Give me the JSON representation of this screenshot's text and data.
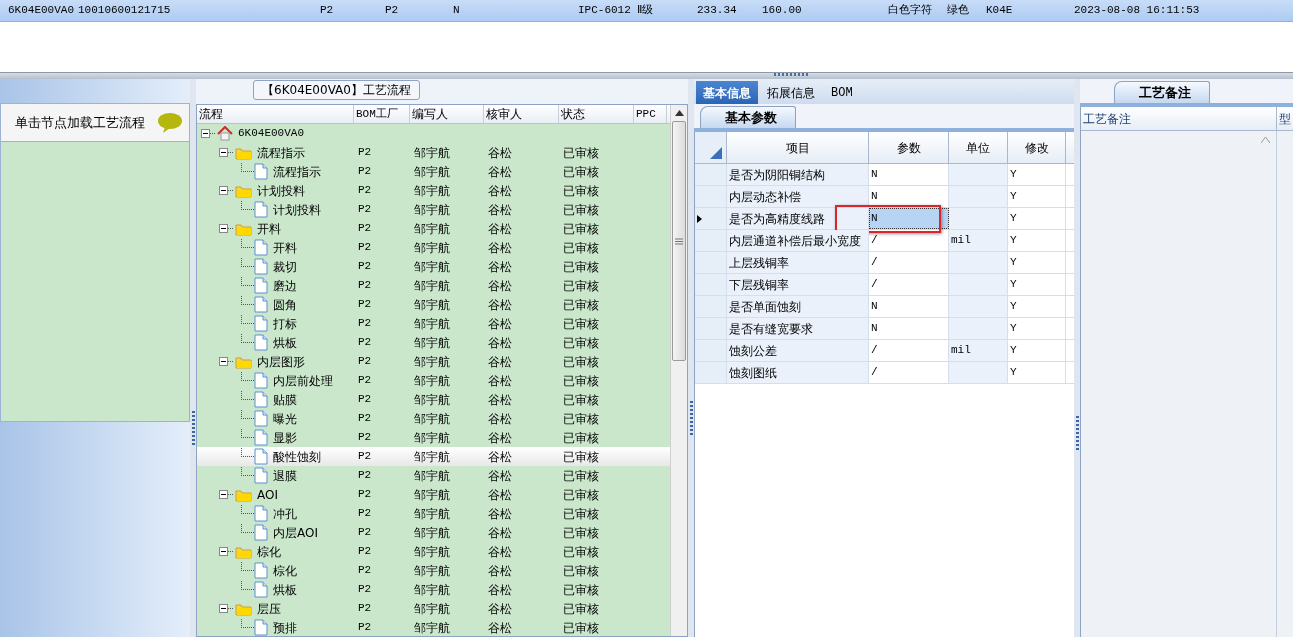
{
  "record_bar": {
    "cells": [
      "6K04E00VA0",
      "10010600121715",
      "P2",
      "P2",
      "N",
      "IPC-6012 Ⅱ级",
      "233.34",
      "160.00",
      "白色字符",
      "绿色",
      "K04E",
      "2023-08-08 16:11:53"
    ]
  },
  "left_panel": {
    "hint": "单击节点加载工艺流程"
  },
  "process_panel": {
    "title": "【6K04E00VA0】工艺流程",
    "columns": [
      "流程",
      "BOM工厂",
      "编写人",
      "核审人",
      "状态",
      "PPC"
    ],
    "tree": [
      {
        "label": "6K04E00VA0",
        "kind": "root",
        "expanded": true,
        "selected": false,
        "children": [
          {
            "label": "流程指示",
            "kind": "folder",
            "expanded": true,
            "selected": false,
            "bom_plant": "P2",
            "writer": "邹宇航",
            "reviewer": "谷松",
            "status": "已审核",
            "children": [
              {
                "label": "流程指示",
                "kind": "step",
                "selected": false,
                "bom_plant": "P2",
                "writer": "邹宇航",
                "reviewer": "谷松",
                "status": "已审核"
              }
            ]
          },
          {
            "label": "计划投料",
            "kind": "folder",
            "expanded": true,
            "selected": false,
            "bom_plant": "P2",
            "writer": "邹宇航",
            "reviewer": "谷松",
            "status": "已审核",
            "children": [
              {
                "label": "计划投料",
                "kind": "step",
                "selected": false,
                "bom_plant": "P2",
                "writer": "邹宇航",
                "reviewer": "谷松",
                "status": "已审核"
              }
            ]
          },
          {
            "label": "开料",
            "kind": "folder",
            "expanded": true,
            "selected": false,
            "bom_plant": "P2",
            "writer": "邹宇航",
            "reviewer": "谷松",
            "status": "已审核",
            "children": [
              {
                "label": "开料",
                "kind": "step",
                "selected": false,
                "bom_plant": "P2",
                "writer": "邹宇航",
                "reviewer": "谷松",
                "status": "已审核"
              },
              {
                "label": "裁切",
                "kind": "step",
                "selected": false,
                "bom_plant": "P2",
                "writer": "邹宇航",
                "reviewer": "谷松",
                "status": "已审核"
              },
              {
                "label": "磨边",
                "kind": "step",
                "selected": false,
                "bom_plant": "P2",
                "writer": "邹宇航",
                "reviewer": "谷松",
                "status": "已审核"
              },
              {
                "label": "圆角",
                "kind": "step",
                "selected": false,
                "bom_plant": "P2",
                "writer": "邹宇航",
                "reviewer": "谷松",
                "status": "已审核"
              },
              {
                "label": "打标",
                "kind": "step",
                "selected": false,
                "bom_plant": "P2",
                "writer": "邹宇航",
                "reviewer": "谷松",
                "status": "已审核"
              },
              {
                "label": "烘板",
                "kind": "step",
                "selected": false,
                "bom_plant": "P2",
                "writer": "邹宇航",
                "reviewer": "谷松",
                "status": "已审核"
              }
            ]
          },
          {
            "label": "内层图形",
            "kind": "folder",
            "expanded": true,
            "selected": false,
            "bom_plant": "P2",
            "writer": "邹宇航",
            "reviewer": "谷松",
            "status": "已审核",
            "children": [
              {
                "label": "内层前处理",
                "kind": "step",
                "selected": false,
                "bom_plant": "P2",
                "writer": "邹宇航",
                "reviewer": "谷松",
                "status": "已审核"
              },
              {
                "label": "贴膜",
                "kind": "step",
                "selected": false,
                "bom_plant": "P2",
                "writer": "邹宇航",
                "reviewer": "谷松",
                "status": "已审核"
              },
              {
                "label": "曝光",
                "kind": "step",
                "selected": false,
                "bom_plant": "P2",
                "writer": "邹宇航",
                "reviewer": "谷松",
                "status": "已审核"
              },
              {
                "label": "显影",
                "kind": "step",
                "selected": false,
                "bom_plant": "P2",
                "writer": "邹宇航",
                "reviewer": "谷松",
                "status": "已审核"
              },
              {
                "label": "酸性蚀刻",
                "kind": "step",
                "selected": true,
                "bom_plant": "P2",
                "writer": "邹宇航",
                "reviewer": "谷松",
                "status": "已审核"
              },
              {
                "label": "退膜",
                "kind": "step",
                "selected": false,
                "bom_plant": "P2",
                "writer": "邹宇航",
                "reviewer": "谷松",
                "status": "已审核"
              }
            ]
          },
          {
            "label": "AOI",
            "kind": "folder",
            "expanded": true,
            "selected": false,
            "bom_plant": "P2",
            "writer": "邹宇航",
            "reviewer": "谷松",
            "status": "已审核",
            "children": [
              {
                "label": "冲孔",
                "kind": "step",
                "selected": false,
                "bom_plant": "P2",
                "writer": "邹宇航",
                "reviewer": "谷松",
                "status": "已审核"
              },
              {
                "label": "内层AOI",
                "kind": "step",
                "selected": false,
                "bom_plant": "P2",
                "writer": "邹宇航",
                "reviewer": "谷松",
                "status": "已审核"
              }
            ]
          },
          {
            "label": "棕化",
            "kind": "folder",
            "expanded": true,
            "selected": false,
            "bom_plant": "P2",
            "writer": "邹宇航",
            "reviewer": "谷松",
            "status": "已审核",
            "children": [
              {
                "label": "棕化",
                "kind": "step",
                "selected": false,
                "bom_plant": "P2",
                "writer": "邹宇航",
                "reviewer": "谷松",
                "status": "已审核"
              },
              {
                "label": "烘板",
                "kind": "step",
                "selected": false,
                "bom_plant": "P2",
                "writer": "邹宇航",
                "reviewer": "谷松",
                "status": "已审核"
              }
            ]
          },
          {
            "label": "层压",
            "kind": "folder",
            "expanded": true,
            "selected": false,
            "bom_plant": "P2",
            "writer": "邹宇航",
            "reviewer": "谷松",
            "status": "已审核",
            "children": [
              {
                "label": "预排",
                "kind": "step",
                "selected": false,
                "bom_plant": "P2",
                "writer": "邹宇航",
                "reviewer": "谷松",
                "status": "已审核"
              }
            ]
          }
        ]
      }
    ]
  },
  "detail_panel": {
    "tabs": [
      {
        "label": "基本信息",
        "selected": true
      },
      {
        "label": "拓展信息",
        "selected": false
      },
      {
        "label": "BOM",
        "selected": false
      }
    ],
    "subtab": {
      "label": "基本参数",
      "selected": true
    },
    "columns": [
      "项目",
      "参数",
      "单位",
      "修改"
    ],
    "rows": [
      {
        "item": "是否为阴阳铜结构",
        "param": "N",
        "modified": "Y",
        "current": false,
        "marked": false
      },
      {
        "item": "内层动态补偿",
        "param": "N",
        "modified": "Y",
        "current": false,
        "marked": false
      },
      {
        "item": "是否为高精度线路",
        "param": "N",
        "modified": "Y",
        "current": true,
        "marked": true
      },
      {
        "item": "内层通道补偿后最小宽度",
        "param": "/",
        "unit": "mil",
        "modified": "Y",
        "current": false,
        "marked": false
      },
      {
        "item": "上层残铜率",
        "param": "/",
        "modified": "Y",
        "current": false,
        "marked": false
      },
      {
        "item": "下层残铜率",
        "param": "/",
        "modified": "Y",
        "current": false,
        "marked": false
      },
      {
        "item": "是否单面蚀刻",
        "param": "N",
        "modified": "Y",
        "current": false,
        "marked": false
      },
      {
        "item": "是否有缝宽要求",
        "param": "N",
        "modified": "Y",
        "current": false,
        "marked": false
      },
      {
        "item": "蚀刻公差",
        "param": "/",
        "unit": "mil",
        "modified": "Y",
        "current": false,
        "marked": false
      },
      {
        "item": "蚀刻图纸",
        "param": "/",
        "modified": "Y",
        "current": false,
        "marked": false
      }
    ]
  },
  "notes_panel": {
    "tab": {
      "label": "工艺备注",
      "selected": true
    },
    "columns": [
      "工艺备注",
      "型"
    ]
  }
}
